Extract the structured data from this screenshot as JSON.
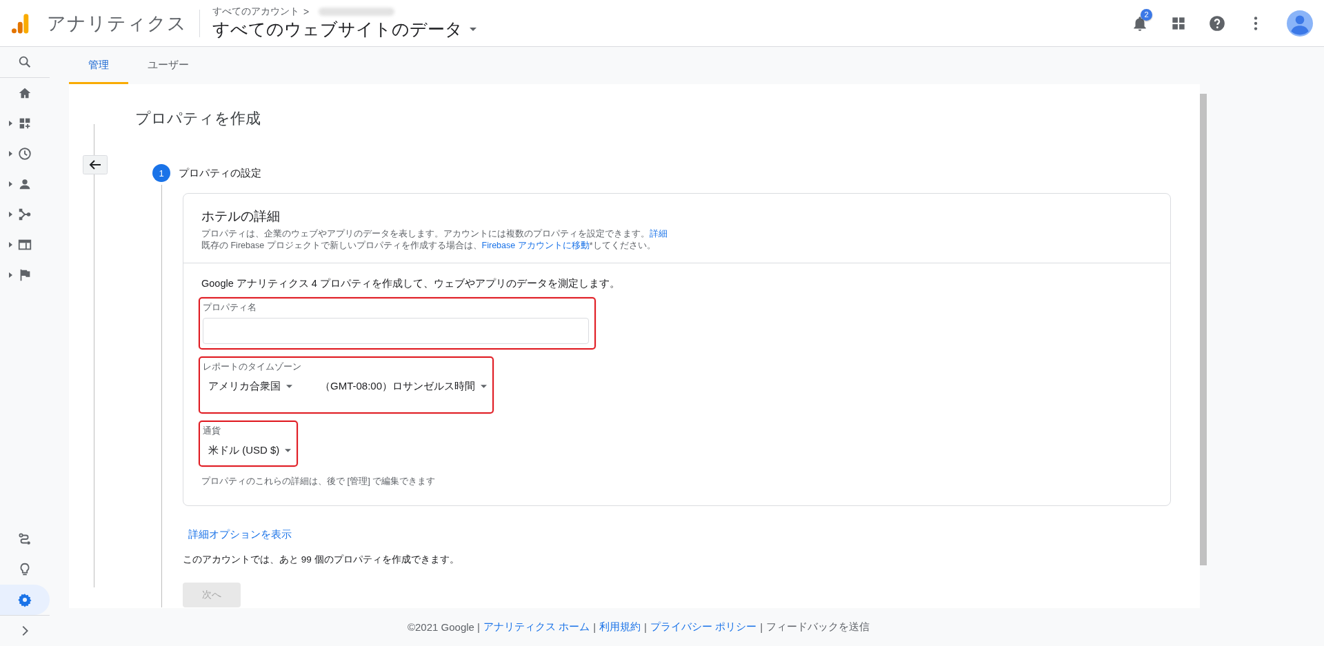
{
  "header": {
    "app_name": "アナリティクス",
    "breadcrumb_parent": "すべてのアカウント",
    "breadcrumb_separator": ">",
    "view": "すべてのウェブサイトのデータ",
    "notification_count": "2"
  },
  "sidebar": {
    "items": [
      {
        "kind": "search",
        "expandable": false,
        "selected": false
      },
      {
        "kind": "home",
        "expandable": false,
        "selected": false
      },
      {
        "kind": "dashboard",
        "expandable": true,
        "selected": false
      },
      {
        "kind": "clock",
        "expandable": true,
        "selected": false
      },
      {
        "kind": "person",
        "expandable": true,
        "selected": false
      },
      {
        "kind": "fork",
        "expandable": true,
        "selected": false
      },
      {
        "kind": "window",
        "expandable": true,
        "selected": false
      },
      {
        "kind": "flag",
        "expandable": true,
        "selected": false
      }
    ],
    "bottom_items": [
      {
        "kind": "route",
        "expandable": false,
        "selected": false
      },
      {
        "kind": "bulb",
        "expandable": false,
        "selected": false
      },
      {
        "kind": "gear",
        "expandable": false,
        "selected": true
      },
      {
        "kind": "chevron",
        "expandable": false,
        "selected": false
      }
    ]
  },
  "tabs": [
    {
      "label": "管理",
      "selected": true
    },
    {
      "label": "ユーザー",
      "selected": false
    }
  ],
  "page": {
    "title": "プロパティを作成",
    "step": {
      "number": "1",
      "label": "プロパティの設定"
    },
    "card": {
      "title": "ホテルの詳細",
      "lines": [
        [
          {
            "text": "プロパティは、企業のウェブやアプリのデータを表します。アカウントには複数のプロパティを設定できます。",
            "link": false
          },
          {
            "text": "詳細",
            "link": true
          }
        ],
        [
          {
            "text": "既存の Firebase プロジェクトで新しいプロパティを作成する場合は、",
            "link": false
          },
          {
            "text": "Firebase アカウントに移動",
            "link": true
          },
          {
            "text": "*してください。",
            "link": false
          }
        ]
      ],
      "intro": "Google アナリティクス 4 プロパティを作成して、ウェブやアプリのデータを測定します。",
      "fields": [
        {
          "kind": "text",
          "label": "プロパティ名",
          "highlighted": true
        },
        {
          "kind": "dropdowns",
          "label": "レポートのタイムゾーン",
          "values": [
            "アメリカ合衆国",
            "（GMT-08:00）ロサンゼルス時間"
          ],
          "highlighted": true
        },
        {
          "kind": "dropdowns",
          "label": "通貨",
          "values": [
            "米ドル (USD $)"
          ],
          "highlighted": true
        }
      ],
      "note": "プロパティのこれらの詳細は、後で [管理] で編集できます"
    },
    "advanced_link": "詳細オプションを表示",
    "remaining": "このアカウントでは、あと 99 個のプロパティを作成できます。",
    "next_button": {
      "label": "次へ",
      "disabled": true
    }
  },
  "footer": [
    {
      "text": "©2021 Google |",
      "link": false
    },
    {
      "text": "アナリティクス ホーム",
      "link": true
    },
    {
      "text": "|",
      "link": false
    },
    {
      "text": "利用規約",
      "link": true
    },
    {
      "text": "|",
      "link": false
    },
    {
      "text": "プライバシー ポリシー",
      "link": true
    },
    {
      "text": "|",
      "link": false
    },
    {
      "text": "フィードバックを送信",
      "link": false
    }
  ]
}
